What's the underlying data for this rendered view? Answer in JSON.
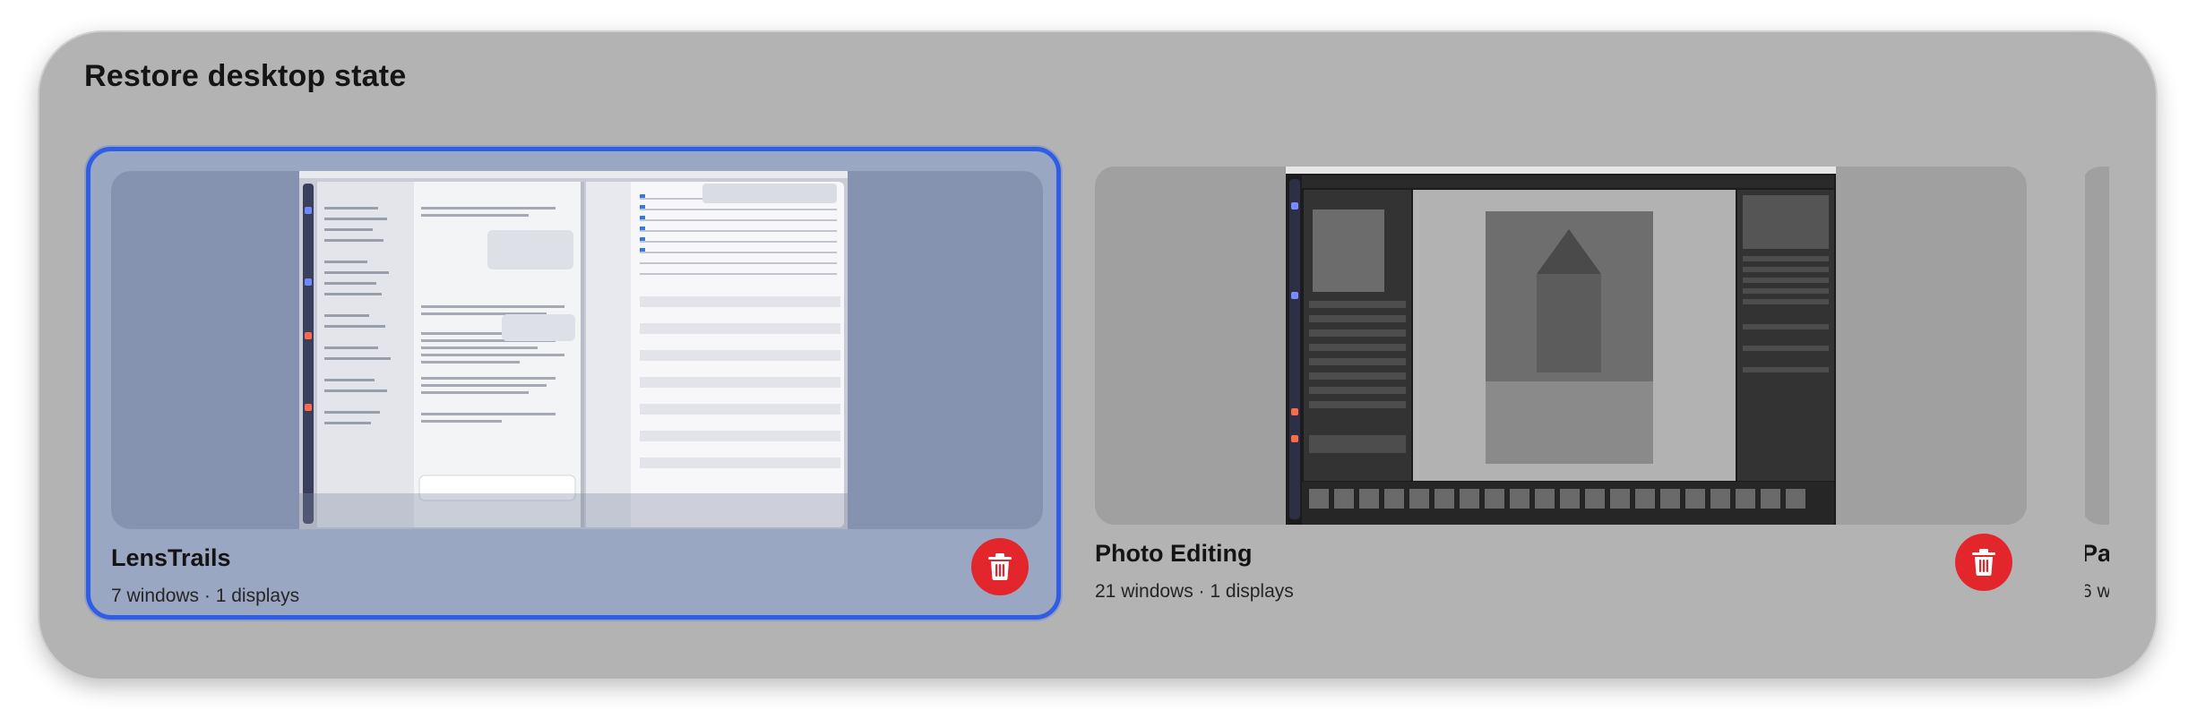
{
  "dialog": {
    "title": "Restore desktop state"
  },
  "states": [
    {
      "name": "LensTrails",
      "summary": "7 windows · 1 displays",
      "selected": true
    },
    {
      "name": "Photo Editing",
      "summary": "21 windows · 1 displays",
      "selected": false
    },
    {
      "name": "Pa",
      "summary": "6 w",
      "selected": false
    }
  ],
  "icons": {
    "delete": "trash-icon"
  },
  "colors": {
    "accent": "#2f5de4",
    "selected_card": "#99a7c3",
    "delete_button": "#e2262c",
    "panel": "#b3b3b3"
  }
}
